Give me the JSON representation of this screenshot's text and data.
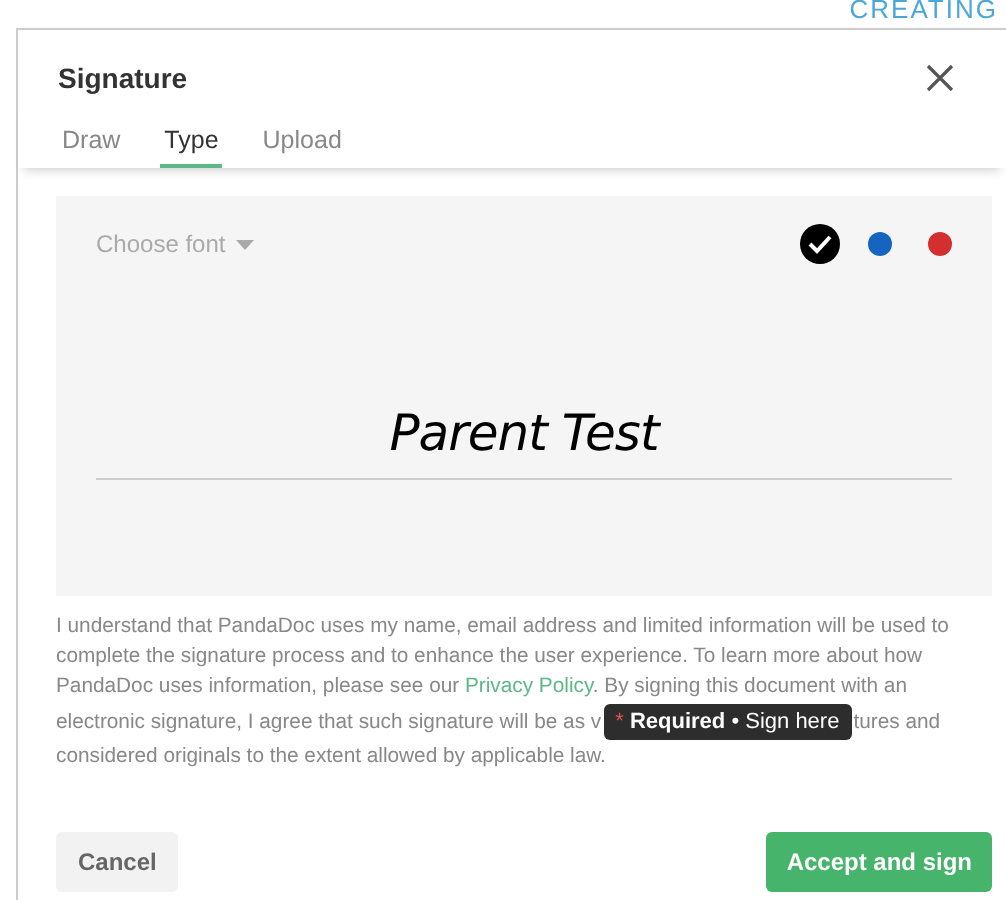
{
  "background": {
    "heading": "CREATING"
  },
  "dialog": {
    "title": "Signature",
    "tabs": [
      {
        "label": "Draw",
        "selected": false
      },
      {
        "label": "Type",
        "selected": true
      },
      {
        "label": "Upload",
        "selected": false
      }
    ],
    "font_picker": {
      "label": "Choose font"
    },
    "colors": [
      {
        "color": "#000000",
        "selected": true
      },
      {
        "color": "#1565c0",
        "selected": false
      },
      {
        "color": "#d32f2f",
        "selected": false
      }
    ],
    "signature": "Parent Test",
    "consent": {
      "before": "I understand that PandaDoc uses my name, email address and limited information will be used to complete the signature process and to enhance the user experience. To learn more about how PandaDoc uses information, please see our ",
      "link": "Privacy Policy",
      "middle": ". By signing this document with an",
      "row_left": "electronic signature, I agree that such signature will be as v",
      "row_right": "tures and",
      "after": "considered originals to the extent allowed by applicable law."
    },
    "tooltip": {
      "mark": "*",
      "strong": "Required",
      "separator": "•",
      "text": "Sign here"
    },
    "buttons": [
      {
        "kind": "secondary",
        "label": "Cancel"
      },
      {
        "kind": "primary",
        "label": "Accept and sign"
      }
    ]
  }
}
